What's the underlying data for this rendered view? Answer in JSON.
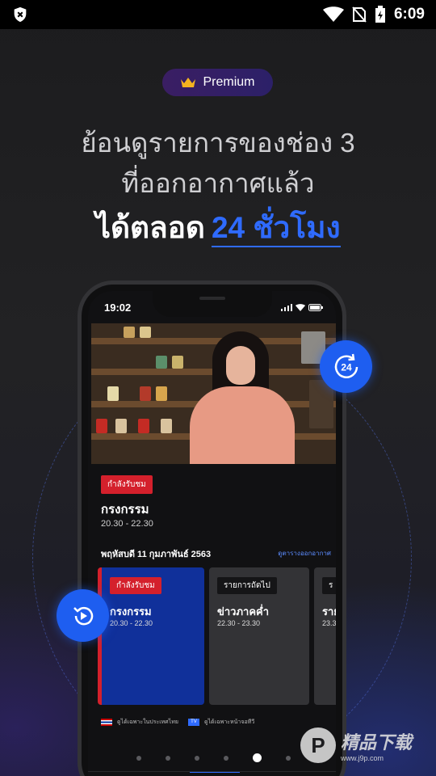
{
  "status_bar": {
    "time": "6:09",
    "icons": [
      "shield-x-icon",
      "wifi-icon",
      "no-sim-icon",
      "battery-charging-icon"
    ]
  },
  "promo": {
    "badge_label": "Premium",
    "badge_icon": "crown-icon",
    "headline_line1": "ย้อนดูรายการของช่อง 3",
    "headline_line2": "ที่ออกอากาศแล้ว",
    "headline_line3_prefix": "ได้ตลอด",
    "headline_line3_accent": "24 ชั่วโมง",
    "accent_color": "#2f6bff"
  },
  "phone": {
    "time": "19:02",
    "now_playing": {
      "badge": "กำลังรับชม",
      "title": "กรงกรรม",
      "time": "20.30 - 22.30"
    },
    "schedule": {
      "date": "พฤหัสบดี 11 กุมภาพันธ์ 2563",
      "link": "ดูตารางออกอากาศ",
      "cards": [
        {
          "tag": "กำลังรับชม",
          "title": "กรงกรรม",
          "time": "20.30 - 22.30"
        },
        {
          "tag": "รายการถัดไป",
          "title": "ข่าวภาคค่ำ",
          "time": "22.30 - 23.30"
        },
        {
          "tag": "ร",
          "title": "ราย",
          "time": "23.3"
        }
      ]
    },
    "legend": {
      "item1": "ดูได้เฉพาะในประเทศไทย",
      "item2_chip": "TV",
      "item2": "ดูได้เฉพาะหน้าจอทีวี"
    },
    "nav_icons": [
      "home-icon",
      "search-icon",
      "play-icon",
      "expand-icon",
      "user-icon"
    ]
  },
  "fabs": {
    "timer_label": "24",
    "timer_icon": "24-hour-replay-icon",
    "replay_icon": "replay-icon"
  },
  "watermark": {
    "badge": "P",
    "name": "精品下载",
    "url": "www.j9p.com"
  }
}
